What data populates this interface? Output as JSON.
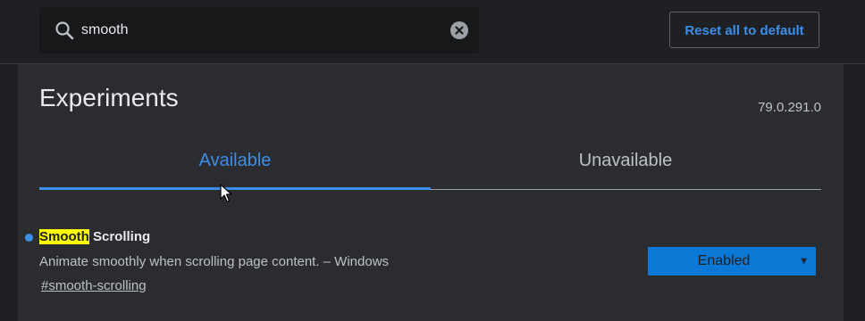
{
  "search": {
    "value": "smooth",
    "icon": "search-icon",
    "clear_icon": "close-icon"
  },
  "toolbar": {
    "reset_label": "Reset all to default"
  },
  "page": {
    "title": "Experiments",
    "version": "79.0.291.0"
  },
  "tabs": [
    {
      "label": "Available",
      "selected": true
    },
    {
      "label": "Unavailable",
      "selected": false
    }
  ],
  "experiment": {
    "title_highlight": "Smooth",
    "title_rest": " Scrolling",
    "description": "Animate smoothly when scrolling page content. – Windows",
    "link": "#smooth-scrolling",
    "state": "Enabled",
    "modified": true
  },
  "colors": {
    "accent": "#3b8eea",
    "select_bg": "#0a78d4",
    "highlight": "#ffff00",
    "panel": "#2b2c30",
    "background": "#1f2023"
  }
}
